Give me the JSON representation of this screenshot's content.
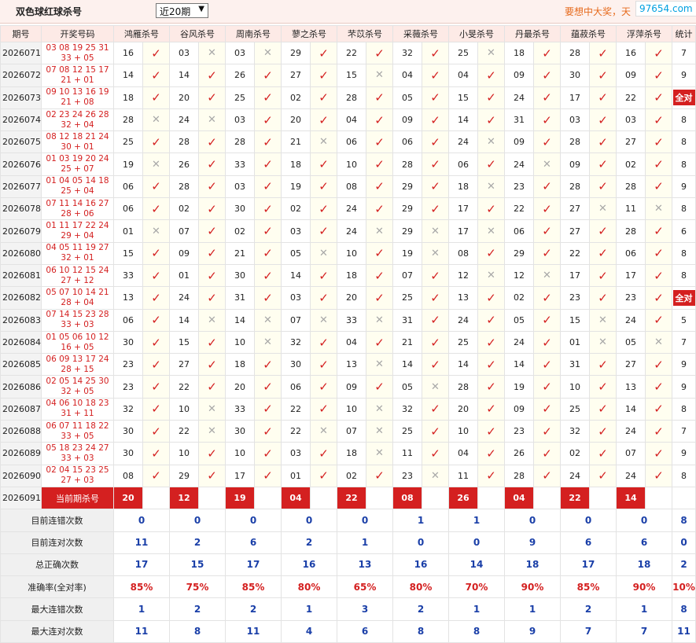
{
  "header": {
    "title": "双色球红球杀号",
    "period": "近20期",
    "promo": "要想中大奖，天",
    "site": "97654.com"
  },
  "columns": {
    "issue": "期号",
    "winning": "开奖号码",
    "stats": "统计"
  },
  "experts": [
    "鸿雁杀号",
    "谷风杀号",
    "周南杀号",
    "蓼之杀号",
    "芣苡杀号",
    "采薇杀号",
    "小旻杀号",
    "丹最杀号",
    "蕴菽杀号",
    "浮萍杀号"
  ],
  "rows": [
    {
      "issue": "2026071",
      "win": "03 08 19 25 31 33 + 05",
      "picks": [
        "16",
        "03",
        "03",
        "29",
        "22",
        "32",
        "25",
        "18",
        "28",
        "16"
      ],
      "ok": [
        1,
        0,
        0,
        1,
        1,
        1,
        0,
        1,
        1,
        1
      ],
      "stat": "7",
      "all": false
    },
    {
      "issue": "2026072",
      "win": "07 08 12 15 17 21 + 01",
      "picks": [
        "14",
        "14",
        "26",
        "27",
        "15",
        "04",
        "04",
        "09",
        "30",
        "09"
      ],
      "ok": [
        1,
        1,
        1,
        1,
        0,
        1,
        1,
        1,
        1,
        1
      ],
      "stat": "9",
      "all": false
    },
    {
      "issue": "2026073",
      "win": "09 10 13 16 19 21 + 08",
      "picks": [
        "18",
        "20",
        "25",
        "02",
        "28",
        "05",
        "15",
        "24",
        "17",
        "22"
      ],
      "ok": [
        1,
        1,
        1,
        1,
        1,
        1,
        1,
        1,
        1,
        1
      ],
      "stat": "全对",
      "all": true
    },
    {
      "issue": "2026074",
      "win": "02 23 24 26 28 32 + 04",
      "picks": [
        "28",
        "24",
        "03",
        "20",
        "04",
        "09",
        "14",
        "31",
        "03",
        "03"
      ],
      "ok": [
        0,
        0,
        1,
        1,
        1,
        1,
        1,
        1,
        1,
        1
      ],
      "stat": "8",
      "all": false
    },
    {
      "issue": "2026075",
      "win": "08 12 18 21 24 30 + 01",
      "picks": [
        "25",
        "28",
        "28",
        "21",
        "06",
        "06",
        "24",
        "09",
        "28",
        "27"
      ],
      "ok": [
        1,
        1,
        1,
        0,
        1,
        1,
        0,
        1,
        1,
        1
      ],
      "stat": "8",
      "all": false
    },
    {
      "issue": "2026076",
      "win": "01 03 19 20 24 25 + 07",
      "picks": [
        "19",
        "26",
        "33",
        "18",
        "10",
        "28",
        "06",
        "24",
        "09",
        "02"
      ],
      "ok": [
        0,
        1,
        1,
        1,
        1,
        1,
        1,
        0,
        1,
        1
      ],
      "stat": "8",
      "all": false
    },
    {
      "issue": "2026077",
      "win": "01 04 05 14 18 25 + 04",
      "picks": [
        "06",
        "28",
        "03",
        "19",
        "08",
        "29",
        "18",
        "23",
        "28",
        "28"
      ],
      "ok": [
        1,
        1,
        1,
        1,
        1,
        1,
        0,
        1,
        1,
        1
      ],
      "stat": "9",
      "all": false
    },
    {
      "issue": "2026078",
      "win": "07 11 14 16 27 28 + 06",
      "picks": [
        "06",
        "02",
        "30",
        "02",
        "24",
        "29",
        "17",
        "22",
        "27",
        "11"
      ],
      "ok": [
        1,
        1,
        1,
        1,
        1,
        1,
        1,
        1,
        0,
        0
      ],
      "stat": "8",
      "all": false
    },
    {
      "issue": "2026079",
      "win": "01 11 17 22 24 29 + 04",
      "picks": [
        "01",
        "07",
        "02",
        "03",
        "24",
        "29",
        "17",
        "06",
        "27",
        "28"
      ],
      "ok": [
        0,
        1,
        1,
        1,
        0,
        0,
        0,
        1,
        1,
        1
      ],
      "stat": "6",
      "all": false
    },
    {
      "issue": "2026080",
      "win": "04 05 11 19 27 32 + 01",
      "picks": [
        "15",
        "09",
        "21",
        "05",
        "10",
        "19",
        "08",
        "29",
        "22",
        "06"
      ],
      "ok": [
        1,
        1,
        1,
        0,
        1,
        0,
        1,
        1,
        1,
        1
      ],
      "stat": "8",
      "all": false
    },
    {
      "issue": "2026081",
      "win": "06 10 12 15 24 27 + 12",
      "picks": [
        "33",
        "01",
        "30",
        "14",
        "18",
        "07",
        "12",
        "12",
        "17",
        "17"
      ],
      "ok": [
        1,
        1,
        1,
        1,
        1,
        1,
        0,
        0,
        1,
        1
      ],
      "stat": "8",
      "all": false
    },
    {
      "issue": "2026082",
      "win": "05 07 10 14 21 28 + 04",
      "picks": [
        "13",
        "24",
        "31",
        "03",
        "20",
        "25",
        "13",
        "02",
        "23",
        "23"
      ],
      "ok": [
        1,
        1,
        1,
        1,
        1,
        1,
        1,
        1,
        1,
        1
      ],
      "stat": "全对",
      "all": true
    },
    {
      "issue": "2026083",
      "win": "07 14 15 23 28 33 + 03",
      "picks": [
        "06",
        "14",
        "14",
        "07",
        "33",
        "31",
        "24",
        "05",
        "15",
        "24"
      ],
      "ok": [
        1,
        0,
        0,
        0,
        0,
        1,
        1,
        1,
        0,
        1
      ],
      "stat": "5",
      "all": false
    },
    {
      "issue": "2026084",
      "win": "01 05 06 10 12 16 + 05",
      "picks": [
        "30",
        "15",
        "10",
        "32",
        "04",
        "21",
        "25",
        "24",
        "01",
        "05"
      ],
      "ok": [
        1,
        1,
        0,
        1,
        1,
        1,
        1,
        1,
        0,
        0
      ],
      "stat": "7",
      "all": false
    },
    {
      "issue": "2026085",
      "win": "06 09 13 17 24 28 + 15",
      "picks": [
        "23",
        "27",
        "18",
        "30",
        "13",
        "14",
        "14",
        "14",
        "31",
        "27"
      ],
      "ok": [
        1,
        1,
        1,
        1,
        0,
        1,
        1,
        1,
        1,
        1
      ],
      "stat": "9",
      "all": false
    },
    {
      "issue": "2026086",
      "win": "02 05 14 25 30 32 + 05",
      "picks": [
        "23",
        "22",
        "20",
        "06",
        "09",
        "05",
        "28",
        "19",
        "10",
        "13"
      ],
      "ok": [
        1,
        1,
        1,
        1,
        1,
        0,
        1,
        1,
        1,
        1
      ],
      "stat": "9",
      "all": false
    },
    {
      "issue": "2026087",
      "win": "04 06 10 18 23 31 + 11",
      "picks": [
        "32",
        "10",
        "33",
        "22",
        "10",
        "32",
        "20",
        "09",
        "25",
        "14"
      ],
      "ok": [
        1,
        0,
        1,
        1,
        0,
        1,
        1,
        1,
        1,
        1
      ],
      "stat": "8",
      "all": false
    },
    {
      "issue": "2026088",
      "win": "06 07 11 18 22 33 + 05",
      "picks": [
        "30",
        "22",
        "30",
        "22",
        "07",
        "25",
        "10",
        "23",
        "32",
        "24"
      ],
      "ok": [
        1,
        0,
        1,
        0,
        0,
        1,
        1,
        1,
        1,
        1
      ],
      "stat": "7",
      "all": false
    },
    {
      "issue": "2026089",
      "win": "05 18 23 24 27 33 + 03",
      "picks": [
        "30",
        "10",
        "10",
        "03",
        "18",
        "11",
        "04",
        "26",
        "02",
        "07"
      ],
      "ok": [
        1,
        1,
        1,
        1,
        0,
        1,
        1,
        1,
        1,
        1
      ],
      "stat": "9",
      "all": false
    },
    {
      "issue": "2026090",
      "win": "02 04 15 23 25 27 + 03",
      "picks": [
        "08",
        "29",
        "17",
        "01",
        "02",
        "23",
        "11",
        "28",
        "24",
        "24"
      ],
      "ok": [
        1,
        1,
        1,
        1,
        1,
        0,
        1,
        1,
        1,
        1
      ],
      "stat": "8",
      "all": false
    }
  ],
  "current": {
    "issue": "2026091",
    "label": "当前期杀号",
    "picks": [
      "20",
      "12",
      "19",
      "04",
      "22",
      "08",
      "26",
      "04",
      "22",
      "14"
    ]
  },
  "footer": [
    {
      "label": "目前连错次数",
      "vals": [
        "0",
        "0",
        "0",
        "0",
        "0",
        "1",
        "1",
        "0",
        "0",
        "0"
      ],
      "stat": "8",
      "red": false
    },
    {
      "label": "目前连对次数",
      "vals": [
        "11",
        "2",
        "6",
        "2",
        "1",
        "0",
        "0",
        "9",
        "6",
        "6"
      ],
      "stat": "0",
      "red": false
    },
    {
      "label": "总正确次数",
      "vals": [
        "17",
        "15",
        "17",
        "16",
        "13",
        "16",
        "14",
        "18",
        "17",
        "18"
      ],
      "stat": "2",
      "red": false
    },
    {
      "label": "准确率(全对率)",
      "vals": [
        "85%",
        "75%",
        "85%",
        "80%",
        "65%",
        "80%",
        "70%",
        "90%",
        "85%",
        "90%"
      ],
      "stat": "10%",
      "red": true
    },
    {
      "label": "最大连错次数",
      "vals": [
        "1",
        "2",
        "2",
        "1",
        "3",
        "2",
        "1",
        "1",
        "2",
        "1"
      ],
      "stat": "8",
      "red": false
    },
    {
      "label": "最大连对次数",
      "vals": [
        "11",
        "8",
        "11",
        "4",
        "6",
        "8",
        "8",
        "9",
        "7",
        "7"
      ],
      "stat": "11",
      "red": false
    }
  ],
  "icons": {
    "correct": "check-icon",
    "wrong": "cross-icon"
  },
  "colors": {
    "accent": "#d42020",
    "header_bg": "#fdeae6",
    "mark_bg": "#fffef0"
  }
}
